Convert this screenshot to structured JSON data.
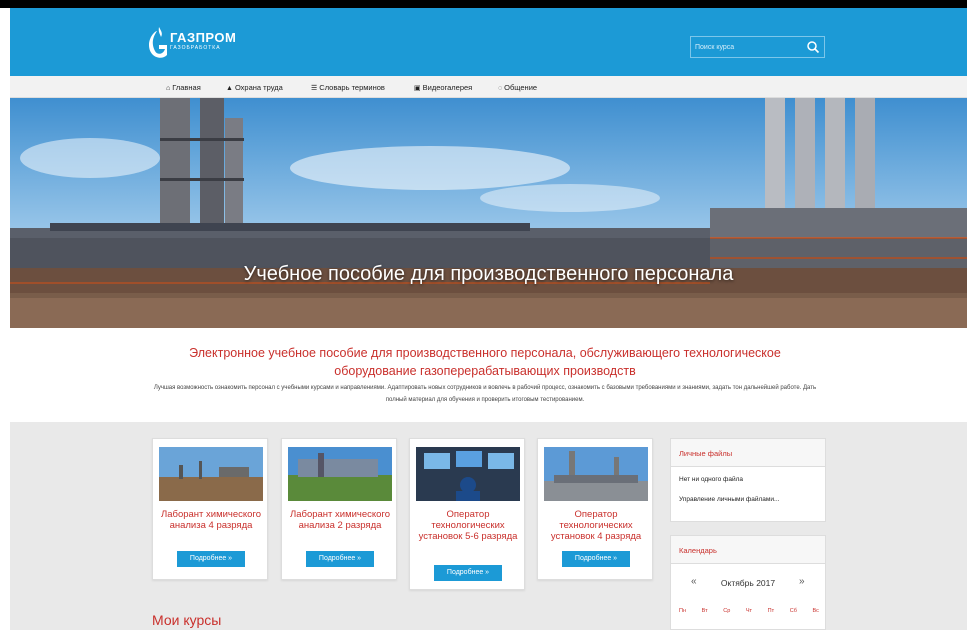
{
  "header": {
    "logo_text": "ГАЗПРОМ",
    "logo_sub": "ГАЗОБРАБОТКА",
    "search_placeholder": "Поиск курса"
  },
  "nav": {
    "items": [
      {
        "label": "Главная",
        "icon": "home-icon"
      },
      {
        "label": "Охрана труда",
        "icon": "graduation-cap-icon"
      },
      {
        "label": "Словарь терминов",
        "icon": "list-icon"
      },
      {
        "label": "Видеогалерея",
        "icon": "video-icon"
      },
      {
        "label": "Общение",
        "icon": "chat-icon"
      }
    ]
  },
  "hero": {
    "title": "Учебное пособие для производственного персонала"
  },
  "intro": {
    "title": "Электронное учебное пособие для производственного персонала, обслуживающего технологическое оборудование газоперерабатывающих производств",
    "text": "Лучшая возможность ознакомить персонал с учебными курсами и направлениями. Адаптировать новых сотрудников и вовлечь в рабочий процесс, ознакомить с базовыми требованиями и знаниями, задать тон дальнейшей работе. Дать полный материал для обучения и проверить итоговым тестированием."
  },
  "cards": [
    {
      "title": "Лаборант химического анализа 4 разряда",
      "button": "Подробнее  »"
    },
    {
      "title": "Лаборант химического анализа 2 разряда",
      "button": "Подробнее  »"
    },
    {
      "title": "Оператор технологических установок 5-6 разряда",
      "button": "Подробнее  »"
    },
    {
      "title": "Оператор технологических установок 4 разряда",
      "button": "Подробнее  »"
    }
  ],
  "sidebar": {
    "files_title": "Личные файлы",
    "files_empty": "Нет ни одного файла",
    "files_manage": "Управление личными файлами...",
    "calendar_title": "Календарь",
    "calendar_month": "Октябрь 2017",
    "calendar_prev": "«",
    "calendar_next": "»",
    "weekdays": [
      "Пн",
      "Вт",
      "Ср",
      "Чт",
      "Пт",
      "Сб",
      "Вс"
    ]
  },
  "main": {
    "my_courses": "Мои курсы"
  },
  "colors": {
    "brand_blue": "#1c9ad6",
    "accent_red": "#c9302c"
  }
}
